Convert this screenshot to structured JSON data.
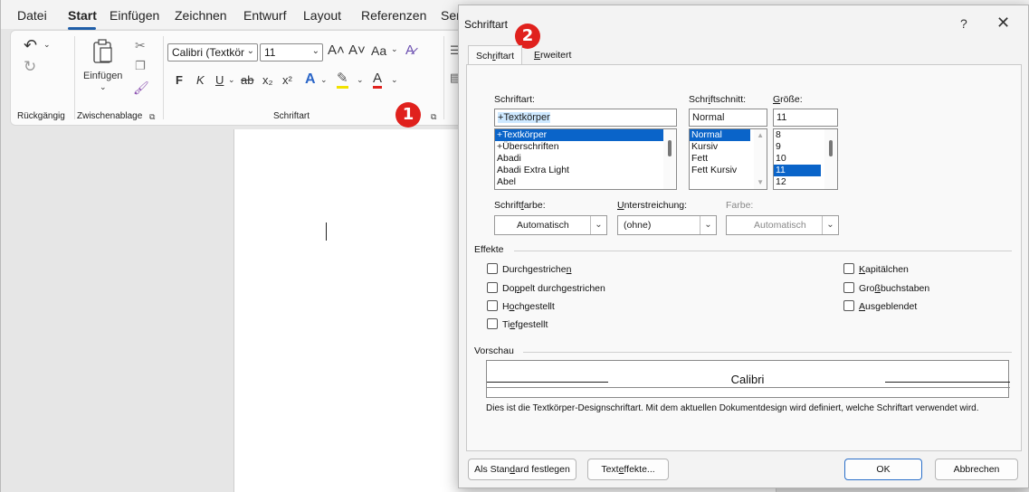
{
  "word": {
    "menu": [
      "Datei",
      "Start",
      "Einfügen",
      "Zeichnen",
      "Entwurf",
      "Layout",
      "Referenzen",
      "Sen"
    ],
    "ribbon": {
      "undo_group_label": "Rückgängig",
      "clipboard_paste_label": "Einfügen",
      "clipboard_group_label": "Zwischenablage",
      "font_name": "Calibri (Textkör",
      "font_size": "11",
      "bold": "F",
      "italic": "K",
      "underline": "U",
      "strike": "ab",
      "subscript": "x₂",
      "superscript": "x²",
      "grow_font": "A˄",
      "shrink_font": "A˅",
      "change_case": "Aa",
      "font_group_label": "Schriftart"
    },
    "badge1": "1"
  },
  "dialog": {
    "title": "Schriftart",
    "help": "?",
    "close": "✕",
    "badge2": "2",
    "tabs": {
      "font_pre": "Sch",
      "font_key": "r",
      "font_post": "iftart",
      "advanced_key": "E",
      "advanced_post": "rweitert"
    },
    "font": {
      "label": "Schriftart:",
      "value": "+Textkörper",
      "list": [
        "+Textkörper",
        "+Überschriften",
        "Abadi",
        "Abadi Extra Light",
        "Abel"
      ]
    },
    "style": {
      "label_pre": "Schr",
      "label_key": "i",
      "label_post": "ftschnitt:",
      "value": "Normal",
      "list": [
        "Normal",
        "Kursiv",
        "Fett",
        "Fett Kursiv"
      ]
    },
    "size": {
      "label_key": "G",
      "label_post": "röße:",
      "value": "11",
      "list": [
        "8",
        "9",
        "10",
        "11",
        "12"
      ]
    },
    "color": {
      "label_pre": "Schrift",
      "label_key": "f",
      "label_post": "arbe:",
      "value": "Automatisch"
    },
    "underline": {
      "label_key": "U",
      "label_post": "nterstreichung:",
      "value": "(ohne)"
    },
    "underline_color": {
      "label": "Farbe:",
      "value": "Automatisch"
    },
    "effects": {
      "title": "Effekte",
      "left": [
        {
          "pre": "Durchgestriche",
          "key": "n",
          "post": ""
        },
        {
          "pre": "Do",
          "key": "p",
          "post": "pelt durchgestrichen"
        },
        {
          "pre": "H",
          "key": "o",
          "post": "chgestellt"
        },
        {
          "pre": "Ti",
          "key": "e",
          "post": "fgestellt"
        }
      ],
      "right": [
        {
          "pre": "",
          "key": "K",
          "post": "apitälchen"
        },
        {
          "pre": "Gro",
          "key": "ß",
          "post": "buchstaben"
        },
        {
          "pre": "",
          "key": "A",
          "post": "usgeblendet"
        }
      ]
    },
    "preview": {
      "title": "Vorschau",
      "sample": "Calibri",
      "description": "Dies ist die Textkörper-Designschriftart. Mit dem aktuellen Dokumentdesign wird definiert, welche Schriftart verwendet wird."
    },
    "buttons": {
      "default_pre": "Als Stan",
      "default_key": "d",
      "default_post": "ard festlegen",
      "effects_pre": "Text",
      "effects_key": "e",
      "effects_post": "ffekte...",
      "ok": "OK",
      "cancel": "Abbrechen"
    }
  }
}
